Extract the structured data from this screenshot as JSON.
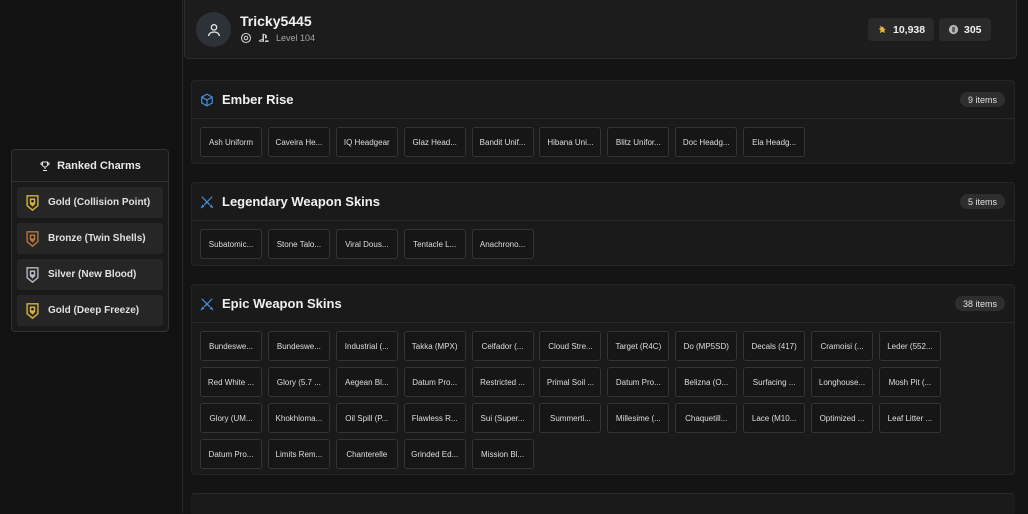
{
  "profile": {
    "username": "Tricky5445",
    "level": "Level 104",
    "renown": "10,938",
    "credits": "305"
  },
  "charms": {
    "title": "Ranked Charms",
    "items": [
      {
        "label": "Gold (Collision Point)",
        "tier": "gold"
      },
      {
        "label": "Bronze (Twin Shells)",
        "tier": "bronze"
      },
      {
        "label": "Silver (New Blood)",
        "tier": "silver"
      },
      {
        "label": "Gold (Deep Freeze)",
        "tier": "gold"
      }
    ]
  },
  "sections": [
    {
      "title": "Ember Rise",
      "count": "9 items",
      "icon": "cube-icon",
      "items": [
        "Ash Uniform",
        "Caveira He...",
        "IQ Headgear",
        "Glaz Head...",
        "Bandit Unif...",
        "Hibana Uni...",
        "Blitz Unifor...",
        "Doc Headg...",
        "Ela Headg..."
      ]
    },
    {
      "title": "Legendary Weapon Skins",
      "count": "5 items",
      "icon": "crossed-swords-icon",
      "items": [
        "Subatomic...",
        "Stone Talo...",
        "Viral Dous...",
        "Tentacle L...",
        "Anachrono..."
      ]
    },
    {
      "title": "Epic Weapon Skins",
      "count": "38 items",
      "icon": "crossed-swords-icon",
      "items": [
        "Bundeswe...",
        "Bundeswe...",
        "Industrial (...",
        "Takka (MPX)",
        "Celfador (...",
        "Cloud Stre...",
        "Target (R4C)",
        "Do (MP5SD)",
        "Decals (417)",
        "Cramoisi (...",
        "Leder (552...",
        "Red White ...",
        "Glory (5.7 ...",
        "Aegean Bl...",
        "Datum Pro...",
        "Restricted ...",
        "Primal Soil ...",
        "Datum Pro...",
        "Belizna (O...",
        "Surfacing ...",
        "Longhouse...",
        "Mosh Pit (...",
        "Glory (UM...",
        "Khokhloma...",
        "Oil Spill (P...",
        "Flawless R...",
        "Sui (Super...",
        "Summerti...",
        "Millesime (...",
        "Chaquetill...",
        "Lace (M10...",
        "Optimized ...",
        "Leaf Litter ...",
        "Datum Pro...",
        "Limits Rem...",
        "Chanterelle",
        "Grinded Ed...",
        "Mission Bl..."
      ]
    }
  ],
  "colors": {
    "gold": "#d9b43a",
    "silver": "#b8bcc4",
    "bronze": "#b8763d",
    "accent_blue": "#4a90e2"
  }
}
